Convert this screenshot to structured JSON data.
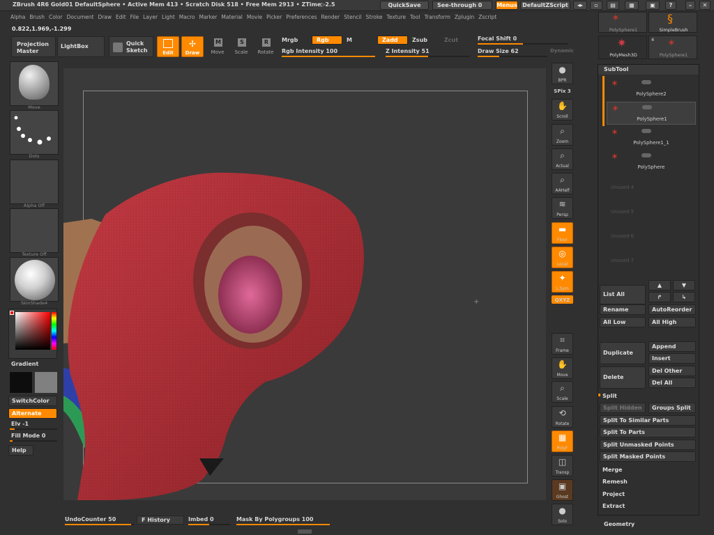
{
  "title_bar": {
    "title": "ZBrush 4R6 Gold01   DefaultSphere   • Active Mem 413  • Scratch Disk 518  • Free Mem 2913  • ZTime▷2.5",
    "quicksave": "QuickSave",
    "seethrough": "See-through  0",
    "menus": "Menus",
    "zscript": "DefaultZScript"
  },
  "menu_bar": [
    "Alpha",
    "Brush",
    "Color",
    "Document",
    "Draw",
    "Edit",
    "File",
    "Layer",
    "Light",
    "Macro",
    "Marker",
    "Material",
    "Movie",
    "Picker",
    "Preferences",
    "Render",
    "Stencil",
    "Stroke",
    "Texture",
    "Tool",
    "Transform",
    "Zplugin",
    "Zscript"
  ],
  "coords": "0.822,1.969,-1.299",
  "toolbar": {
    "projection_master": "Projection Master",
    "lightbox": "LightBox",
    "quick_sketch": "Quick Sketch",
    "edit": "Edit",
    "draw": "Draw",
    "move": "Move",
    "scale": "Scale",
    "rotate": "Rotate",
    "mrgb": "Mrgb",
    "rgb": "Rgb",
    "m": "M",
    "zadd": "Zadd",
    "zsub": "Zsub",
    "zcut": "Zcut",
    "rgb_intensity": "Rgb Intensity 100",
    "z_intensity": "Z Intensity 51",
    "focal_shift": "Focal Shift 0",
    "draw_size": "Draw Size 62",
    "dynamic": "Dynamic"
  },
  "left_shelf": {
    "brush_label": "Move",
    "stroke_label": "Dots",
    "alpha_label": "Alpha Off",
    "texture_label": "Texture Off",
    "material_label": "SkinShade4",
    "gradient": "Gradient",
    "switchcolor": "SwitchColor",
    "alternate": "Alternate",
    "elv": "Elv -1",
    "fill_mode": "Fill Mode 0",
    "help": "Help"
  },
  "right_shelf": [
    {
      "name": "bpr",
      "label": "BPR"
    },
    {
      "name": "spix",
      "label": "SPix 3"
    },
    {
      "name": "scroll",
      "label": "Scroll"
    },
    {
      "name": "zoom",
      "label": "Zoom"
    },
    {
      "name": "actual",
      "label": "Actual"
    },
    {
      "name": "aahalf",
      "label": "AAHalf"
    },
    {
      "name": "persp",
      "label": "Persp"
    },
    {
      "name": "floor",
      "label": "Floor"
    },
    {
      "name": "local",
      "label": "Local"
    },
    {
      "name": "lsym",
      "label": "L.Sym"
    },
    {
      "name": "xyz",
      "label": "QXYZ"
    },
    {
      "name": "frame",
      "label": "Frame"
    },
    {
      "name": "move",
      "label": "Move"
    },
    {
      "name": "scale",
      "label": "Scale"
    },
    {
      "name": "rotate",
      "label": "Rotate"
    },
    {
      "name": "polyf",
      "label": "PolyF"
    },
    {
      "name": "transp",
      "label": "Transp"
    },
    {
      "name": "ghost",
      "label": "Ghost"
    },
    {
      "name": "solo",
      "label": "Solo"
    }
  ],
  "tool_thumbs": {
    "polysphere1_top": "PolySphere1",
    "simplebrush": "SimpleBrush",
    "polymesh3d": "PolyMesh3D",
    "polysphere1": "PolySphere1",
    "count": "4"
  },
  "subtool": {
    "header": "SubTool",
    "items": [
      "PolySphere2",
      "PolySphere1",
      "PolySphere1_1",
      "PolySphere"
    ],
    "empty": [
      "Unused 4",
      "Unused 5",
      "Unused 6",
      "Unused 7"
    ]
  },
  "panel": {
    "list_all": "List All",
    "rename": "Rename",
    "autoreorder": "AutoReorder",
    "all_low": "All Low",
    "all_high": "All High",
    "duplicate": "Duplicate",
    "append": "Append",
    "insert": "Insert",
    "delete": "Delete",
    "del_other": "Del Other",
    "del_all": "Del All",
    "split": "Split",
    "split_hidden": "Split Hidden",
    "groups_split": "Groups Split",
    "split_similar": "Split To Similar Parts",
    "split_parts": "Split To Parts",
    "split_unmasked": "Split Unmasked Points",
    "split_masked": "Split Masked Points",
    "merge": "Merge",
    "remesh": "Remesh",
    "project": "Project",
    "extract": "Extract",
    "geometry": "Geometry"
  },
  "bottom": {
    "undo_counter": "UndoCounter 50",
    "f_history": "F History",
    "imbed": "Imbed 0",
    "mask_by_polygroups": "Mask By Polygroups 100"
  },
  "colors": {
    "accent": "#ff8a00",
    "mesh_red": "#b8343b",
    "background": "#303030"
  }
}
